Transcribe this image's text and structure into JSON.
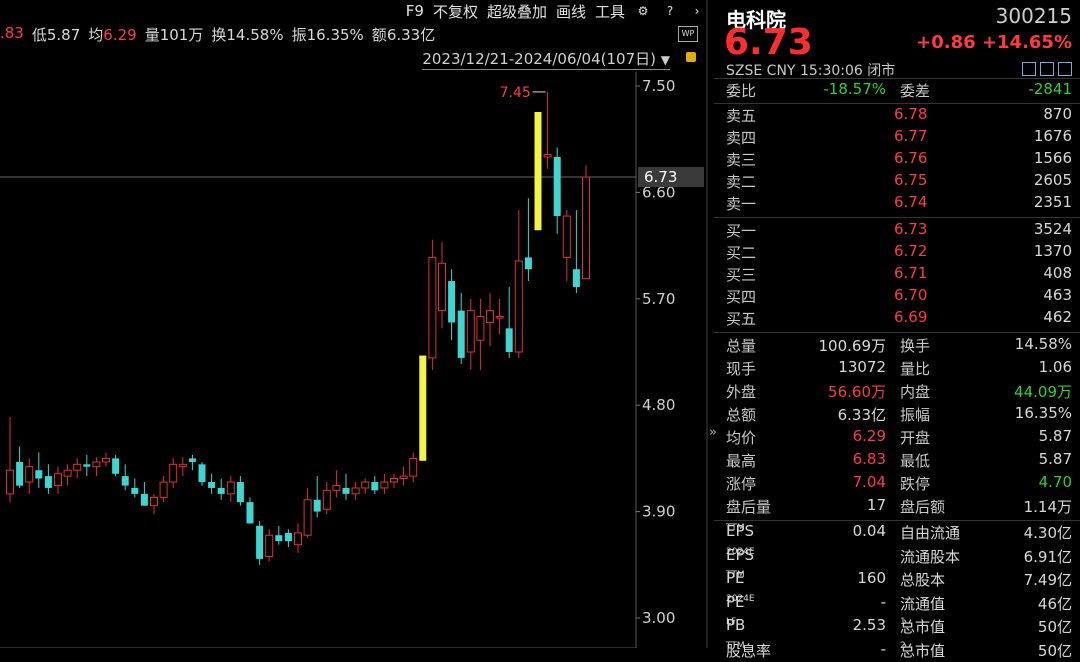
{
  "header": {
    "low_partial": ".83",
    "stats": [
      {
        "label": "低",
        "value": "5.87",
        "color": "white"
      },
      {
        "label": "均",
        "value": "6.29",
        "color": "red"
      },
      {
        "label": "量",
        "value": "101万",
        "color": "white"
      },
      {
        "label": "换",
        "value": "14.58%",
        "color": "white"
      },
      {
        "label": "振",
        "value": "16.35%",
        "color": "white"
      },
      {
        "label": "额",
        "value": "6.33亿",
        "color": "white"
      }
    ],
    "menu": [
      "F9",
      "不复权",
      "超级叠加",
      "画线",
      "工具"
    ],
    "date_range": "2023/12/21-2024/06/04(107日)",
    "wp": "WP"
  },
  "chart_data": {
    "type": "candlestick",
    "y_ticks": [
      "7.50",
      "6.60",
      "5.70",
      "4.80",
      "3.90",
      "3.00"
    ],
    "ylim": [
      3.0,
      7.5
    ],
    "current_price": "6.73",
    "high_marker": "7.45",
    "colors": {
      "up": "#e03030",
      "down": "#3dd6d0",
      "limit": "#f2f542"
    }
  },
  "quote": {
    "name": "电科院",
    "code": "300215",
    "price": "6.73",
    "change": "+0.86",
    "change_pct": "+14.65%",
    "exchange": "SZSE",
    "currency": "CNY",
    "time": "15:30:06",
    "status": "闭市"
  },
  "order_book": {
    "weibi_label": "委比",
    "weibi_value": "-18.57%",
    "weicha_label": "委差",
    "weicha_value": "-2841",
    "asks": [
      {
        "label": "卖五",
        "price": "6.78",
        "volume": "870"
      },
      {
        "label": "卖四",
        "price": "6.77",
        "volume": "1676"
      },
      {
        "label": "卖三",
        "price": "6.76",
        "volume": "1566"
      },
      {
        "label": "卖二",
        "price": "6.75",
        "volume": "2605"
      },
      {
        "label": "卖一",
        "price": "6.74",
        "volume": "2351"
      }
    ],
    "bids": [
      {
        "label": "买一",
        "price": "6.73",
        "volume": "3524"
      },
      {
        "label": "买二",
        "price": "6.72",
        "volume": "1370"
      },
      {
        "label": "买三",
        "price": "6.71",
        "volume": "408"
      },
      {
        "label": "买四",
        "price": "6.70",
        "volume": "463"
      },
      {
        "label": "买五",
        "price": "6.69",
        "volume": "462"
      }
    ]
  },
  "stats": [
    {
      "l1": "总量",
      "v1": "100.69万",
      "c1": "white",
      "l2": "换手",
      "v2": "14.58%",
      "c2": "white"
    },
    {
      "l1": "现手",
      "v1": "13072",
      "c1": "white",
      "l2": "量比",
      "v2": "1.06",
      "c2": "white"
    },
    {
      "l1": "外盘",
      "v1": "56.60万",
      "c1": "red",
      "l2": "内盘",
      "v2": "44.09万",
      "c2": "green"
    },
    {
      "l1": "总额",
      "v1": "6.33亿",
      "c1": "white",
      "l2": "振幅",
      "v2": "16.35%",
      "c2": "white"
    },
    {
      "l1": "均价",
      "v1": "6.29",
      "c1": "red",
      "l2": "开盘",
      "v2": "5.87",
      "c2": "white"
    },
    {
      "l1": "最高",
      "v1": "6.83",
      "c1": "red",
      "l2": "最低",
      "v2": "5.87",
      "c2": "white"
    },
    {
      "l1": "涨停",
      "v1": "7.04",
      "c1": "red",
      "l2": "跌停",
      "v2": "4.70",
      "c2": "green"
    },
    {
      "l1": "盘后量",
      "v1": "17",
      "c1": "white",
      "l2": "盘后额",
      "v2": "1.14万",
      "c2": "white"
    }
  ],
  "fundamentals": [
    {
      "l1": "EPS",
      "s1": "TTM",
      "v1": "0.04",
      "l2": "自由流通",
      "s2": "",
      "v2": "4.30亿"
    },
    {
      "l1": "EPS",
      "s1": "2024E",
      "v1": "",
      "l2": "流通股本",
      "s2": "",
      "v2": "6.91亿"
    },
    {
      "l1": "PE",
      "s1": "TTM",
      "v1": "160",
      "l2": "总股本",
      "s2": "",
      "v2": "7.49亿"
    },
    {
      "l1": "PE",
      "s1": "2024E",
      "v1": "-",
      "l2": "流通值",
      "s2": "",
      "v2": "46亿"
    },
    {
      "l1": "PB",
      "s1": "LF",
      "v1": "2.53",
      "l2": "总市值",
      "s2": "1",
      "v2": "50亿"
    },
    {
      "l1": "股息率",
      "s1": "TTM",
      "v1": "-",
      "l2": "总市值",
      "s2": "2",
      "v2": "50亿"
    }
  ]
}
